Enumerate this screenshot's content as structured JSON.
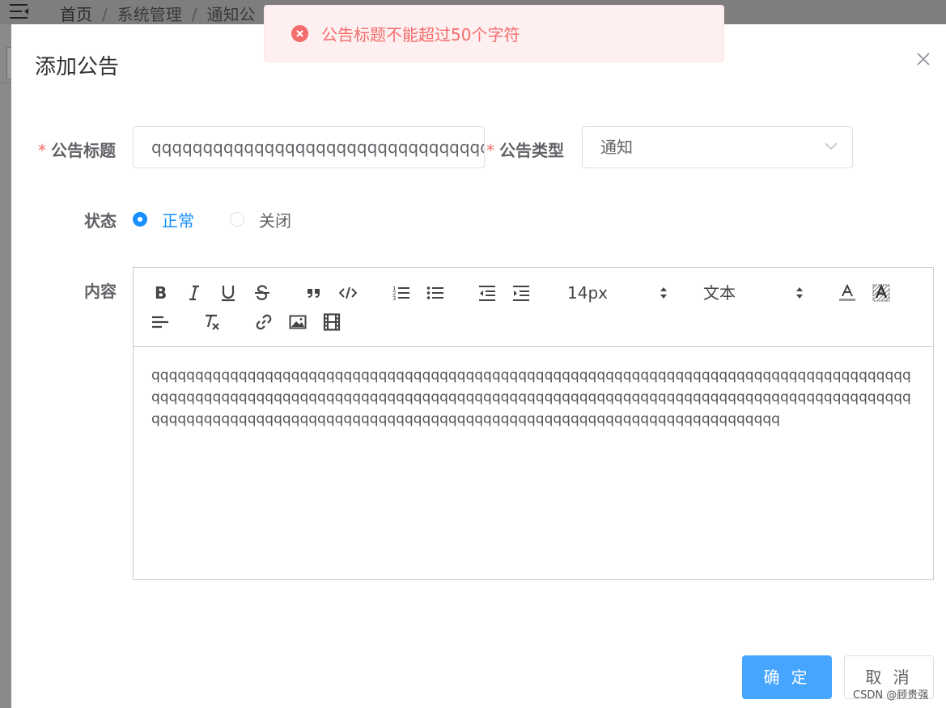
{
  "background": {
    "breadcrumb": [
      "首页",
      "系统管理",
      "通知公"
    ],
    "separator": "/"
  },
  "message": {
    "type": "error",
    "text": "公告标题不能超过50个字符",
    "icon": "error-circle-icon"
  },
  "dialog": {
    "title": "添加公告",
    "form": {
      "title_label": "公告标题",
      "title_value": "qqqqqqqqqqqqqqqqqqqqqqqqqqqqqqqqqqqq",
      "type_label": "公告类型",
      "type_value": "通知",
      "status_label": "状态",
      "status_options": [
        "正常",
        "关闭"
      ],
      "status_selected": "正常",
      "content_label": "内容",
      "required_mark": "*"
    },
    "editor": {
      "font_size": "14px",
      "header": "文本",
      "content": "qqqqqqqqqqqqqqqqqqqqqqqqqqqqqqqqqqqqqqqqqqqqqqqqqqqqqqqqqqqqqqqqqqqqqqqqqqqqqqqqqqqqqqqqqqqqqqqqqqqqqqqqqqqqqqqqqqqqqqqqqqqqqqqqqqqqqqqqqqqqqqqqqqqqqqqqqqqqqqqqqqqqqqqqqqqqqqqqqqqqqqqqqqqqqqqqqqqqqqqqqqqqqqqqqqqqqqqqqqqqqqqqqqqqqqqqqqqqqqqqqqqqqq"
    },
    "buttons": {
      "confirm": "确 定",
      "cancel": "取 消"
    }
  },
  "watermark": "CSDN @顾贵强",
  "colors": {
    "primary": "#1890ff",
    "button_primary": "#46a6ff",
    "error": "#f56c6c",
    "error_bg": "#fef0f0"
  }
}
